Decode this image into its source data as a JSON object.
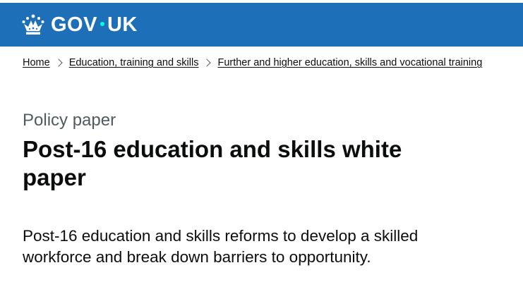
{
  "header": {
    "logo_text_left": "GOV",
    "logo_text_right": "UK",
    "logo_icon": "crown-icon",
    "background_color": "#1d70b8"
  },
  "breadcrumbs": [
    {
      "label": "Home"
    },
    {
      "label": "Education, training and skills"
    },
    {
      "label": "Further and higher education, skills and vocational training"
    }
  ],
  "page": {
    "caption": "Policy paper",
    "title": "Post-16 education and skills white paper",
    "lead": "Post-16 education and skills reforms to develop a skilled workforce and break down barriers to opportunity."
  }
}
